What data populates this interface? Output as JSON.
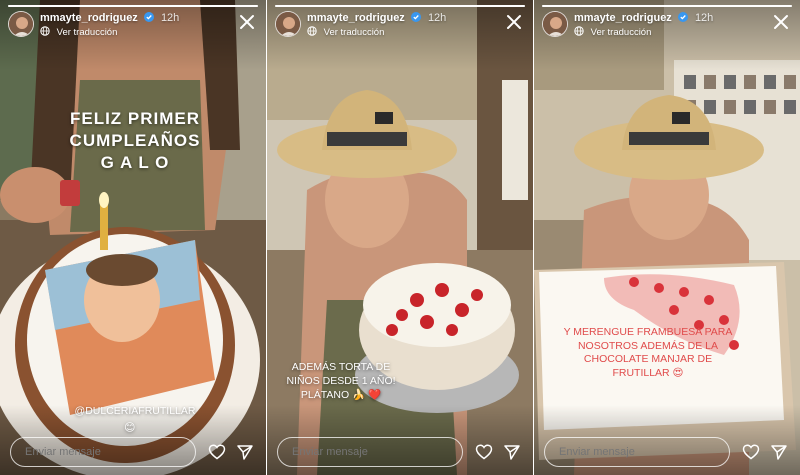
{
  "stories": [
    {
      "username": "mmayte_rodriguez",
      "time": "12h",
      "translate_label": "Ver traducción",
      "caption_lines": [
        "FELIZ PRIMER",
        "CUMPLEAÑOS",
        "G A L O"
      ],
      "handle": "@DULCERIAFRUTILLAR",
      "handle_emoji": "😊",
      "reply_placeholder": "Enviar mensaje"
    },
    {
      "username": "mmayte_rodriguez",
      "time": "12h",
      "translate_label": "Ver traducción",
      "caption_lines": [
        "ADEMÁS TORTA DE",
        "NIÑOS DESDE 1 AÑO!",
        "PLÁTANO 🍌 ❤️"
      ],
      "reply_placeholder": "Enviar mensaje"
    },
    {
      "username": "mmayte_rodriguez",
      "time": "12h",
      "translate_label": "Ver traducción",
      "caption_lines": [
        "Y MERENGUE FRAMBUESA PARA",
        "NOSOTROS ADEMÁS DE LA",
        "CHOCOLATE MANJAR DE",
        "FRUTILLAR 😍"
      ],
      "reply_placeholder": "Enviar mensaje"
    }
  ],
  "colors": {
    "verified": "#3897f0",
    "overlay_text_red": "#e04b4b"
  },
  "icons": {
    "close": "close-icon",
    "heart": "heart-icon",
    "send": "send-icon",
    "verified": "verified-badge-icon",
    "globe": "globe-icon"
  }
}
